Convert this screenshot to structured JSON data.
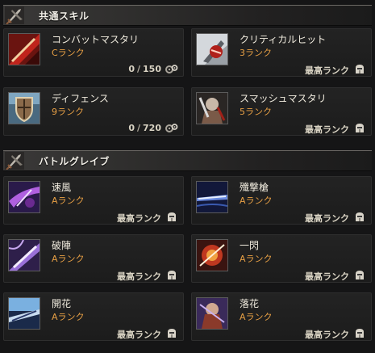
{
  "sections": [
    {
      "title": "共通スキル",
      "icon": "crossed-swords-icon",
      "skills": [
        {
          "name": "コンバットマスタリ",
          "rank": "Cランク",
          "current": "0",
          "max": "150",
          "status_icon": "gears-icon",
          "icon": "combat-mastery-icon"
        },
        {
          "name": "クリティカルヒット",
          "rank": "3ランク",
          "status": "最高ランク",
          "status_icon": "knight-helmet-icon",
          "icon": "critical-hit-icon"
        },
        {
          "name": "ディフェンス",
          "rank": "9ランク",
          "current": "0",
          "max": "720",
          "status_icon": "gears-icon",
          "icon": "defense-shield-icon"
        },
        {
          "name": "スマッシュマスタリ",
          "rank": "5ランク",
          "status": "最高ランク",
          "status_icon": "knight-helmet-icon",
          "icon": "smash-mastery-icon"
        }
      ]
    },
    {
      "title": "バトルグレイブ",
      "icon": "crossed-swords-icon",
      "skills": [
        {
          "name": "速風",
          "rank": "Aランク",
          "status": "最高ランク",
          "status_icon": "knight-helmet-icon",
          "icon": "swift-wind-icon"
        },
        {
          "name": "殲撃槍",
          "rank": "Aランク",
          "status": "最高ランク",
          "status_icon": "knight-helmet-icon",
          "icon": "annihilation-spear-icon"
        },
        {
          "name": "破陣",
          "rank": "Aランク",
          "status": "最高ランク",
          "status_icon": "knight-helmet-icon",
          "icon": "formation-break-icon"
        },
        {
          "name": "一閃",
          "rank": "Aランク",
          "status": "最高ランク",
          "status_icon": "knight-helmet-icon",
          "icon": "flash-strike-icon"
        },
        {
          "name": "開花",
          "rank": "Aランク",
          "status": "最高ランク",
          "status_icon": "knight-helmet-icon",
          "icon": "blossom-icon"
        },
        {
          "name": "落花",
          "rank": "Aランク",
          "status": "最高ランク",
          "status_icon": "knight-helmet-icon",
          "icon": "falling-blossom-icon"
        }
      ]
    }
  ]
}
